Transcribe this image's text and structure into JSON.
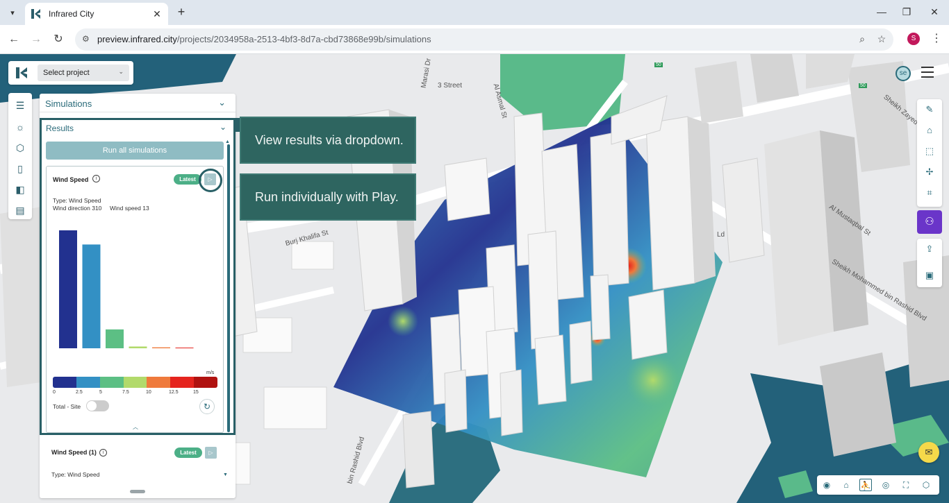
{
  "browser": {
    "tab_title": "Infrared City",
    "url_host": "preview.infrared.city",
    "url_path": "/projects/2034958a-2513-4bf3-8d7a-cbd73868e99b/simulations",
    "profile_initial": "S"
  },
  "header": {
    "project_select_label": "Select project",
    "avatar_initials": "se"
  },
  "map": {
    "street_labels": [
      "Marasi Dr",
      "3 Street",
      "Al Asmal St",
      "Burj Khalifa St",
      "Sheikh Zayed Rd",
      "Al Mustaqbal St",
      "Sheikh Mohammed bin Rashid Blvd",
      "Ld",
      "bin Rashid Blvd"
    ],
    "road_shields": [
      "50",
      "50"
    ]
  },
  "panel": {
    "simulations_label": "Simulations",
    "results_label": "Results",
    "run_all_label": "Run all simulations",
    "card1": {
      "title": "Wind Speed",
      "badge": "Latest",
      "type_line": "Type: Wind Speed",
      "wind_direction": "Wind direction 310",
      "wind_speed": "Wind speed 13",
      "unit": "m/s",
      "legend_ticks": [
        "0",
        "2.5",
        "5",
        "7.5",
        "10",
        "12.5",
        "15"
      ],
      "legend_colors": [
        "#22318f",
        "#3390c4",
        "#5cbf84",
        "#b2da6b",
        "#ef7a3c",
        "#e5241e",
        "#b01210"
      ],
      "toggle_label": "Total - Site"
    },
    "card2": {
      "title": "Wind Speed (1)",
      "badge": "Latest",
      "type_line": "Type: Wind Speed"
    }
  },
  "callouts": {
    "dropdown": "View results via dropdown.",
    "play": "Run individually with Play."
  },
  "chart_data": {
    "type": "bar",
    "categories": [
      "0-2.5",
      "2.5-5",
      "5-7.5",
      "7.5-10",
      "10-12.5",
      "12.5-15"
    ],
    "values": [
      100,
      88,
      16,
      1.5,
      0.8,
      0.3
    ],
    "colors": [
      "#22318f",
      "#3390c4",
      "#5cbf84",
      "#b2da6b",
      "#ef7a3c",
      "#e5241e"
    ],
    "ylim": [
      0,
      100
    ],
    "title": "",
    "xlabel": "",
    "ylabel": ""
  }
}
